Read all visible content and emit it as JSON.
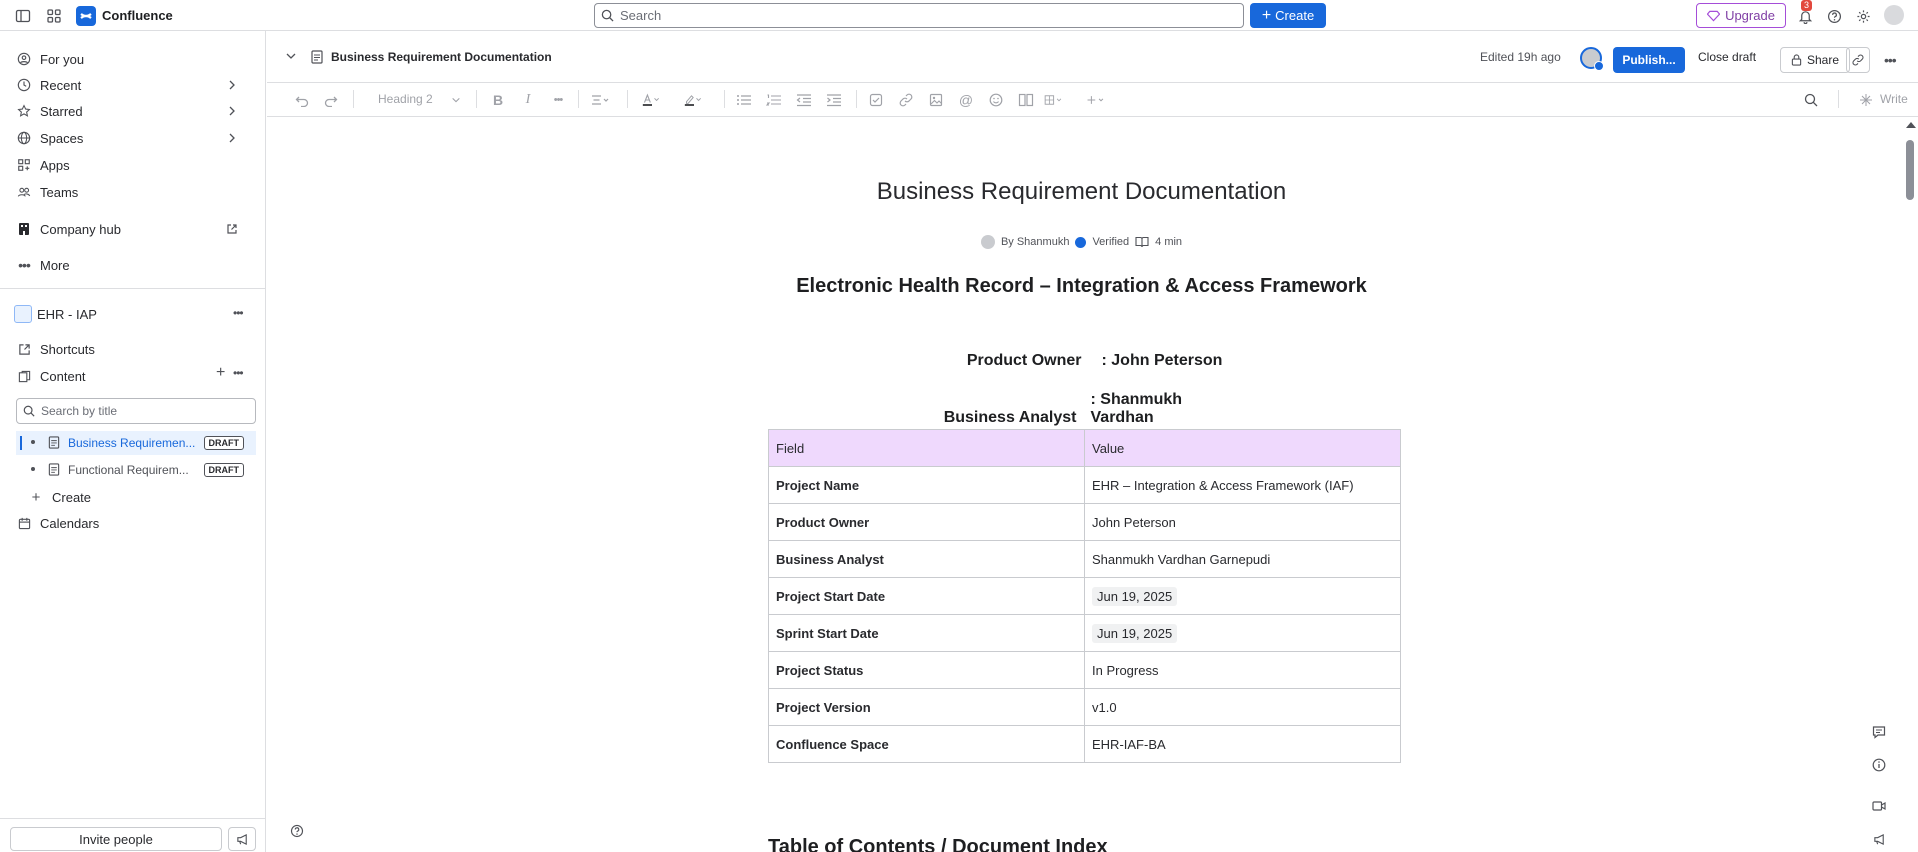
{
  "topbar": {
    "app_name": "Confluence",
    "search_placeholder": "Search",
    "create_label": "Create",
    "upgrade_label": "Upgrade",
    "notification_count": "3"
  },
  "sidebar": {
    "nav": [
      {
        "label": "For you",
        "icon": "person-icon"
      },
      {
        "label": "Recent",
        "icon": "clock-icon"
      },
      {
        "label": "Starred",
        "icon": "star-icon"
      },
      {
        "label": "Spaces",
        "icon": "globe-icon"
      },
      {
        "label": "Apps",
        "icon": "apps-icon"
      },
      {
        "label": "Teams",
        "icon": "people-icon"
      }
    ],
    "company_hub": "Company hub",
    "more": "More",
    "space_name": "EHR - IAP",
    "shortcuts": "Shortcuts",
    "content": "Content",
    "search_placeholder": "Search by title",
    "pages": [
      {
        "title": "Business Requiremen...",
        "badge": "DRAFT"
      },
      {
        "title": "Functional Requirem...",
        "badge": "DRAFT"
      }
    ],
    "create": "Create",
    "calendars": "Calendars",
    "invite": "Invite people"
  },
  "header": {
    "page_title": "Business Requirement Documentation",
    "edited": "Edited 19h ago",
    "publish": "Publish...",
    "close_draft": "Close draft",
    "share": "Share"
  },
  "toolbar": {
    "heading": "Heading 2",
    "write": "Write"
  },
  "document": {
    "title": "Business Requirement Documentation",
    "byline": {
      "author": "By Shanmukh",
      "verified": "Verified",
      "read_time": "4 min"
    },
    "subtitle": "Electronic Health Record – Integration & Access Framework",
    "product_owner_label": "Product Owner",
    "product_owner_value": ": John Peterson",
    "business_analyst_label": "Business Analyst",
    "business_analyst_value": ": Shanmukh Vardhan",
    "table": {
      "headers": [
        "Field",
        "Value"
      ],
      "rows": [
        [
          "Project Name",
          "EHR – Integration & Access Framework (IAF)"
        ],
        [
          "Product Owner",
          "John Peterson"
        ],
        [
          "Business Analyst",
          "Shanmukh Vardhan Garnepudi"
        ],
        [
          "Project Start Date",
          "Jun 19, 2025"
        ],
        [
          "Sprint Start Date",
          "Jun 19, 2025"
        ],
        [
          "Project Status",
          "In Progress"
        ],
        [
          "Project Version",
          "v1.0"
        ],
        [
          "Confluence Space",
          "EHR-IAF-BA"
        ]
      ]
    },
    "toc_heading": "Table of Contents / Document Index"
  },
  "colors": {
    "brand": "#1868db",
    "table_header": "#efd9fd",
    "upgrade": "#a54dd8"
  }
}
